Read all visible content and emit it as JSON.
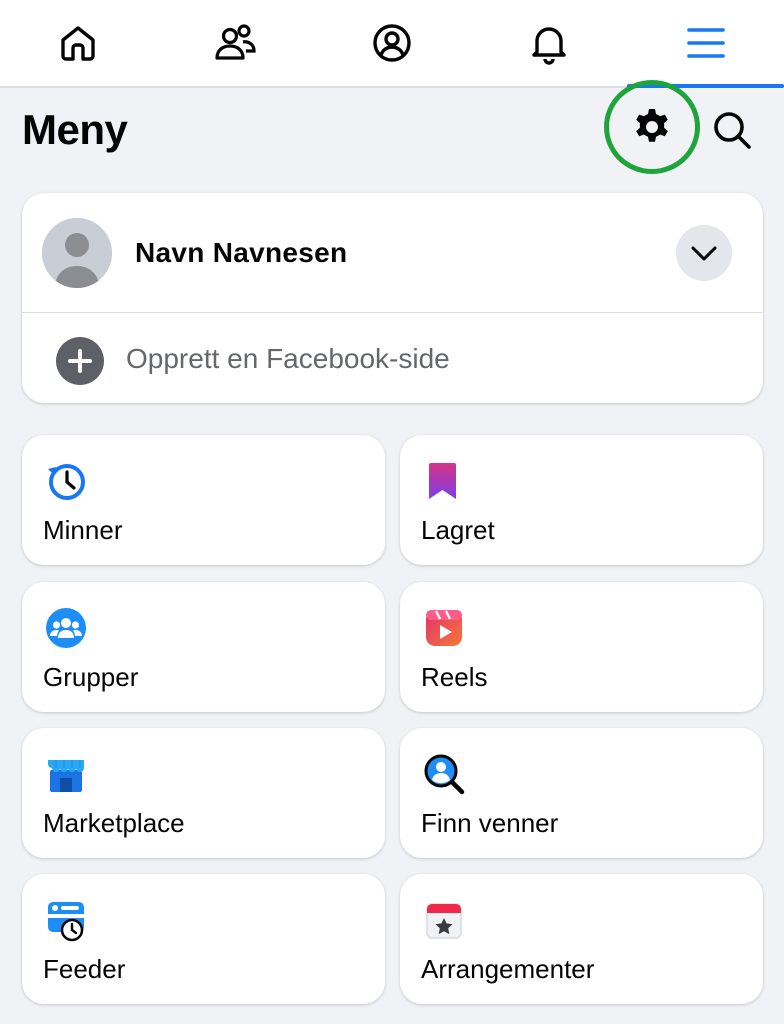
{
  "nav": {
    "tabs": [
      {
        "icon": "home-icon"
      },
      {
        "icon": "friends-icon"
      },
      {
        "icon": "profile-icon"
      },
      {
        "icon": "bell-icon"
      },
      {
        "icon": "menu-icon",
        "active": true
      }
    ],
    "active_color": "#1877f2"
  },
  "header": {
    "title": "Meny",
    "settings_icon": "gear-icon",
    "search_icon": "search-icon",
    "highlight_color": "#1fa43b"
  },
  "profile": {
    "name": "Navn Navnesen",
    "create_page_label": "Opprett en Facebook-side"
  },
  "shortcuts": [
    {
      "label": "Minner",
      "icon": "memories-icon"
    },
    {
      "label": "Lagret",
      "icon": "saved-icon"
    },
    {
      "label": "Grupper",
      "icon": "groups-icon"
    },
    {
      "label": "Reels",
      "icon": "reels-icon"
    },
    {
      "label": "Marketplace",
      "icon": "marketplace-icon"
    },
    {
      "label": "Finn venner",
      "icon": "find-friends-icon"
    },
    {
      "label": "Feeder",
      "icon": "feeds-icon"
    },
    {
      "label": "Arrangementer",
      "icon": "events-icon"
    }
  ]
}
